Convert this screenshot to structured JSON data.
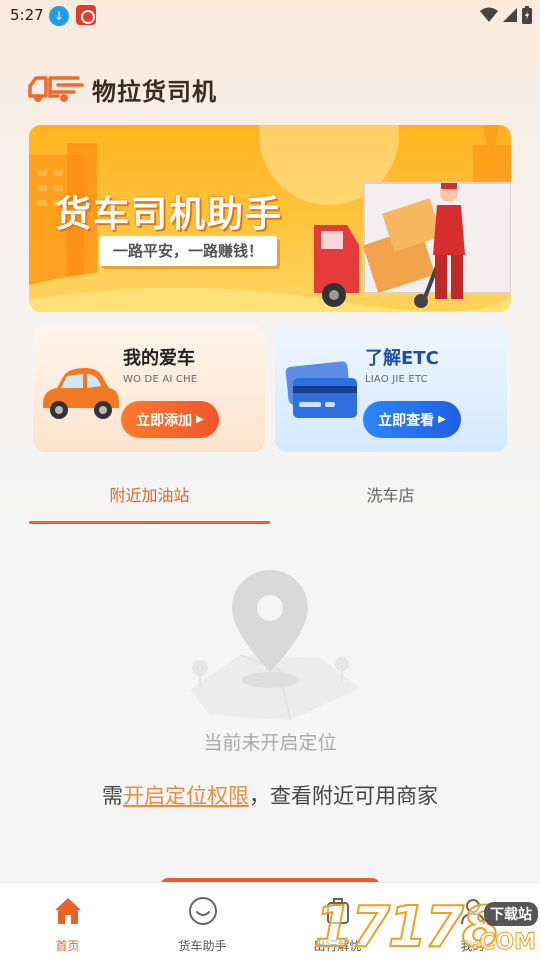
{
  "status_bar": {
    "time": "5:27"
  },
  "app": {
    "title": "物拉货司机"
  },
  "banner": {
    "title": "货车司机助手",
    "subtitle": "一路平安，一路赚钱！"
  },
  "cards": [
    {
      "title": "我的爱车",
      "subtitle": "WO DE AI CHE",
      "button": "立即添加"
    },
    {
      "title": "了解ETC",
      "subtitle": "LIAO JIE ETC",
      "button": "立即查看"
    }
  ],
  "tabs": [
    {
      "label": "附近加油站",
      "active": true
    },
    {
      "label": "洗车店",
      "active": false
    }
  ],
  "empty_state": {
    "message": "当前未开启定位",
    "hint_prefix": "需",
    "hint_link": "开启定位权限",
    "hint_suffix": "，查看附近可用商家"
  },
  "bottom_nav": [
    {
      "label": "首页",
      "icon": "home-icon",
      "active": true
    },
    {
      "label": "货车助手",
      "icon": "chat-icon",
      "active": false
    },
    {
      "label": "出行解忧",
      "icon": "travel-icon",
      "active": false
    },
    {
      "label": "我的",
      "icon": "profile-icon",
      "active": false
    }
  ],
  "watermark": {
    "number": "17178",
    "badge": "下载站",
    "suffix": ".COM"
  },
  "colors": {
    "accent": "#e8632a",
    "etc_blue": "#1f5fe0",
    "banner_yellow": "#ffc23a"
  }
}
